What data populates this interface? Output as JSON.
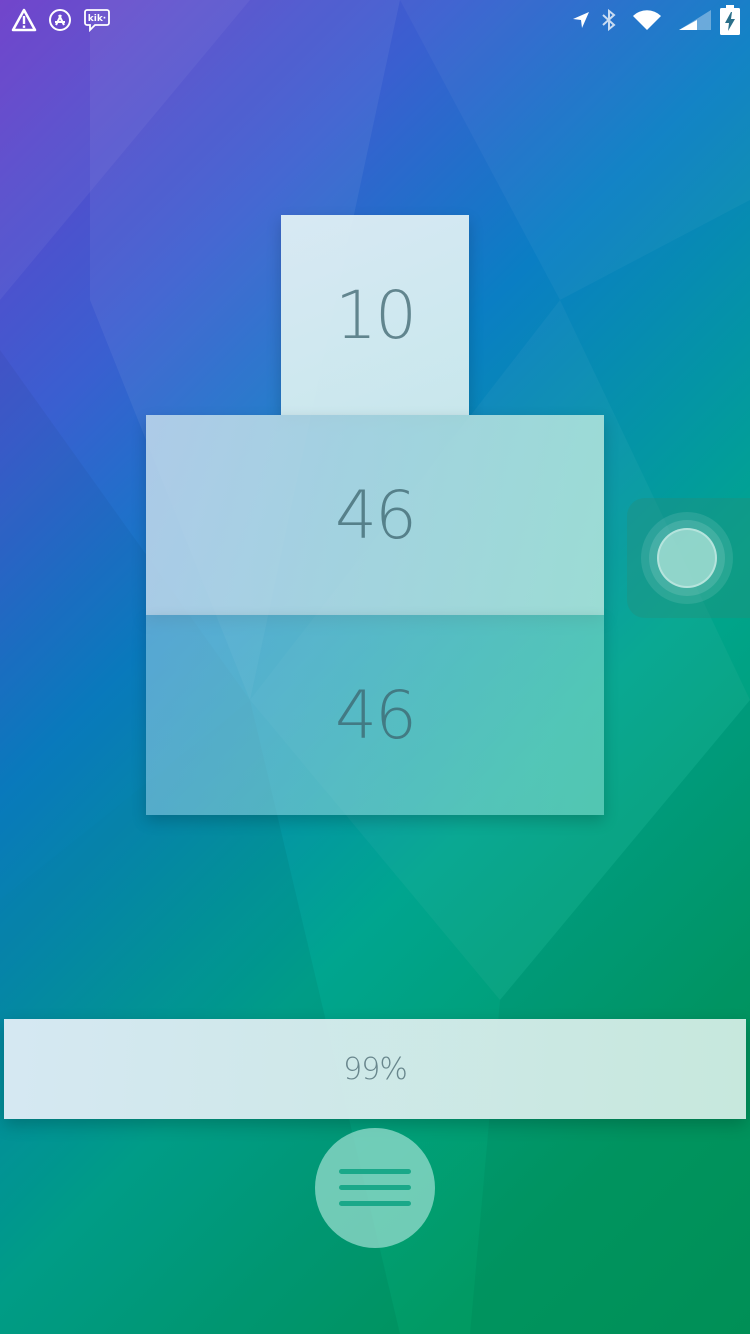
{
  "status_bar": {
    "left_icons": [
      "warning-icon",
      "app-store-icon",
      "kik-icon"
    ],
    "right_icons": [
      "location-arrow-icon",
      "bluetooth-icon",
      "wifi-icon",
      "cell-signal-icon",
      "battery-charging-icon"
    ],
    "kik_label": "kik·"
  },
  "tiles": {
    "top": {
      "value": "10"
    },
    "middle": {
      "value": "46"
    },
    "bottom": {
      "value": "46"
    }
  },
  "progress": {
    "label": "99%",
    "percent": 99
  },
  "menu": {
    "icon": "hamburger-menu-icon"
  },
  "colors": {
    "gradient_start": "#6b3cc9",
    "gradient_mid": "#0a7ec4",
    "gradient_end": "#01955a",
    "tile_text": "#3c646e",
    "menu_lines": "#1aa889"
  }
}
